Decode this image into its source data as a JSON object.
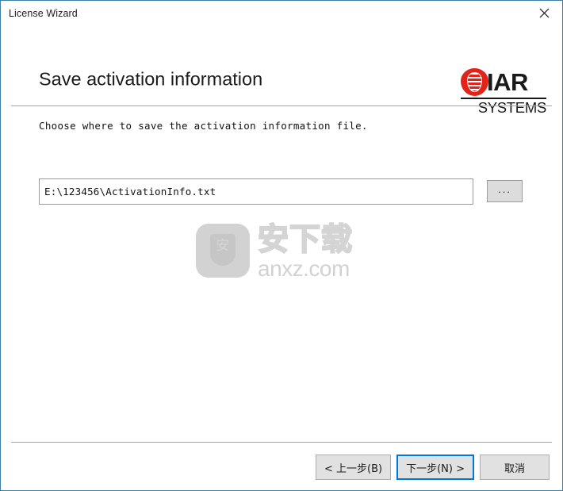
{
  "window": {
    "title": "License Wizard",
    "border_color": "#3f7fa6",
    "close_icon": "close-icon"
  },
  "header": {
    "page_title": "Save activation information",
    "logo": {
      "mark": "iar-circle-emblem",
      "wordmark": "IAR",
      "subtitle": "SYSTEMS",
      "brand_color": "#e2231a"
    }
  },
  "body": {
    "instruction": "Choose where to save the activation information file.",
    "path_field": {
      "value": "E:\\123456\\ActivationInfo.txt",
      "placeholder": ""
    },
    "browse_label": "..."
  },
  "watermark": {
    "badge_glyph": "安",
    "chinese": "安下载",
    "url": "anxz.com"
  },
  "footer": {
    "back_label": "< 上一步(B)",
    "next_label": "下一步(N) >",
    "cancel_label": "取消",
    "focus_color": "#0078d7"
  }
}
